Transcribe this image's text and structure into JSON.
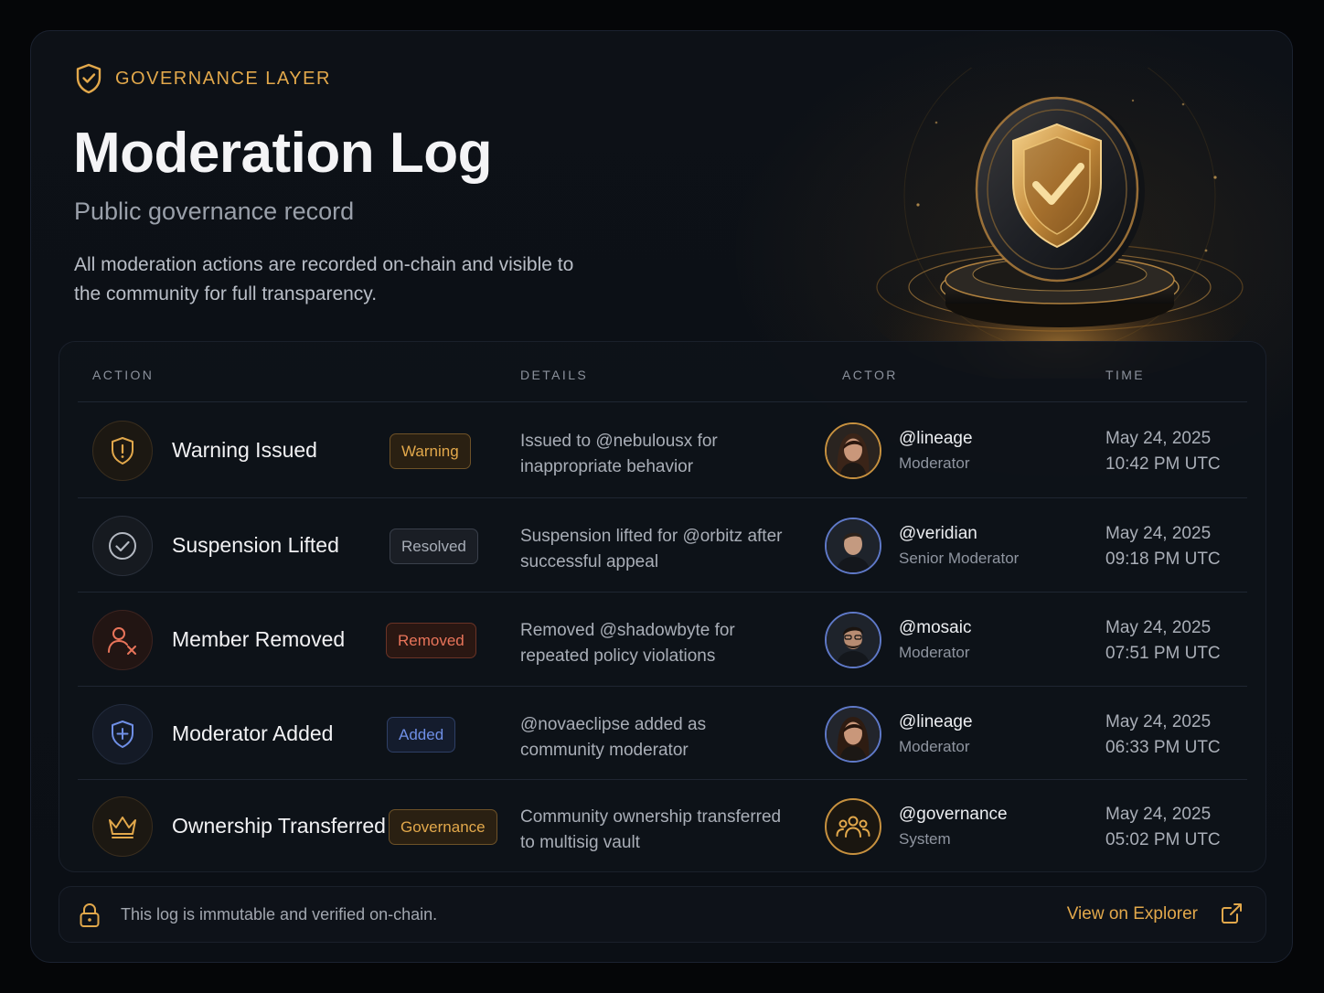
{
  "header": {
    "eyebrow": "GOVERNANCE LAYER",
    "title": "Moderation Log",
    "subtitle": "Public governance record",
    "description": "All moderation actions are recorded on-chain and visible to the community for full transparency."
  },
  "table": {
    "columns": {
      "action": "ACTION",
      "details": "DETAILS",
      "actor": "ACTOR",
      "time": "TIME"
    },
    "rows": [
      {
        "action": "Warning Issued",
        "icon": "warning-shield-icon",
        "badge": "Warning",
        "badge_color": "#e2a84b",
        "details": "Issued to @nebulousx for inappropriate behavior",
        "actor": "@lineage",
        "role": "Moderator",
        "date": "May 24, 2025",
        "time": "10:42 PM UTC"
      },
      {
        "action": "Suspension Lifted",
        "icon": "check-circle-icon",
        "badge": "Resolved",
        "badge_color": "#a7adb7",
        "details": "Suspension lifted for @orbitz after successful appeal",
        "actor": "@veridian",
        "role": "Senior Moderator",
        "date": "May 24, 2025",
        "time": "09:18 PM UTC"
      },
      {
        "action": "Member Removed",
        "icon": "user-remove-icon",
        "badge": "Removed",
        "badge_color": "#e8745a",
        "details": "Removed @shadowbyte for repeated policy violations",
        "actor": "@mosaic",
        "role": "Moderator",
        "date": "May 24, 2025",
        "time": "07:51 PM UTC"
      },
      {
        "action": "Moderator Added",
        "icon": "shield-plus-icon",
        "badge": "Added",
        "badge_color": "#6f8fe6",
        "details": "@novaeclipse added as community moderator",
        "actor": "@lineage",
        "role": "Moderator",
        "date": "May 24, 2025",
        "time": "06:33 PM UTC"
      },
      {
        "action": "Ownership Transferred",
        "icon": "crown-icon",
        "badge": "Governance",
        "badge_color": "#e2a84b",
        "details": "Community ownership transferred to multisig vault",
        "actor": "@governance",
        "role": "System",
        "date": "May 24, 2025",
        "time": "05:02 PM UTC"
      }
    ]
  },
  "footer": {
    "note": "This log is immutable and verified on-chain.",
    "link": "View on Explorer"
  },
  "colors": {
    "accent": "#e2a84b",
    "background": "#0b0f15"
  }
}
